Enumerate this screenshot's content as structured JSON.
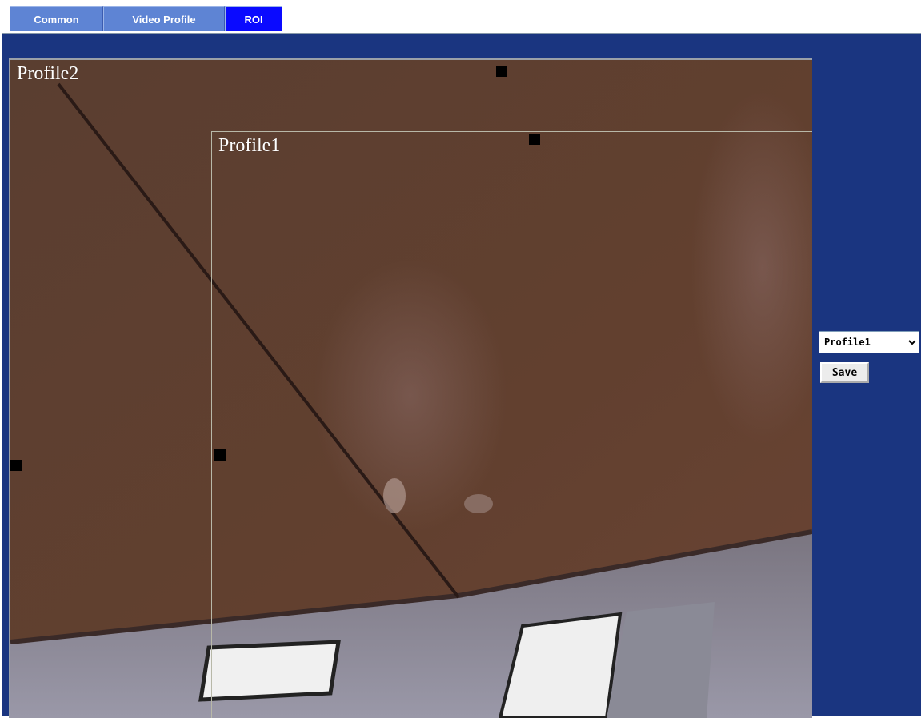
{
  "tabs": [
    {
      "label": "Common"
    },
    {
      "label": "Video Profile"
    },
    {
      "label": "ROI",
      "active": true
    }
  ],
  "video": {
    "rois": [
      {
        "label": "Profile2"
      },
      {
        "label": "Profile1"
      }
    ]
  },
  "controls": {
    "profile_select": {
      "selected": "Profile1",
      "options": [
        "Profile1"
      ]
    },
    "save_label": "Save"
  },
  "colors": {
    "background": "#1a3580",
    "tab_inactive": "#5e84d4",
    "tab_active": "#0a0aff"
  }
}
